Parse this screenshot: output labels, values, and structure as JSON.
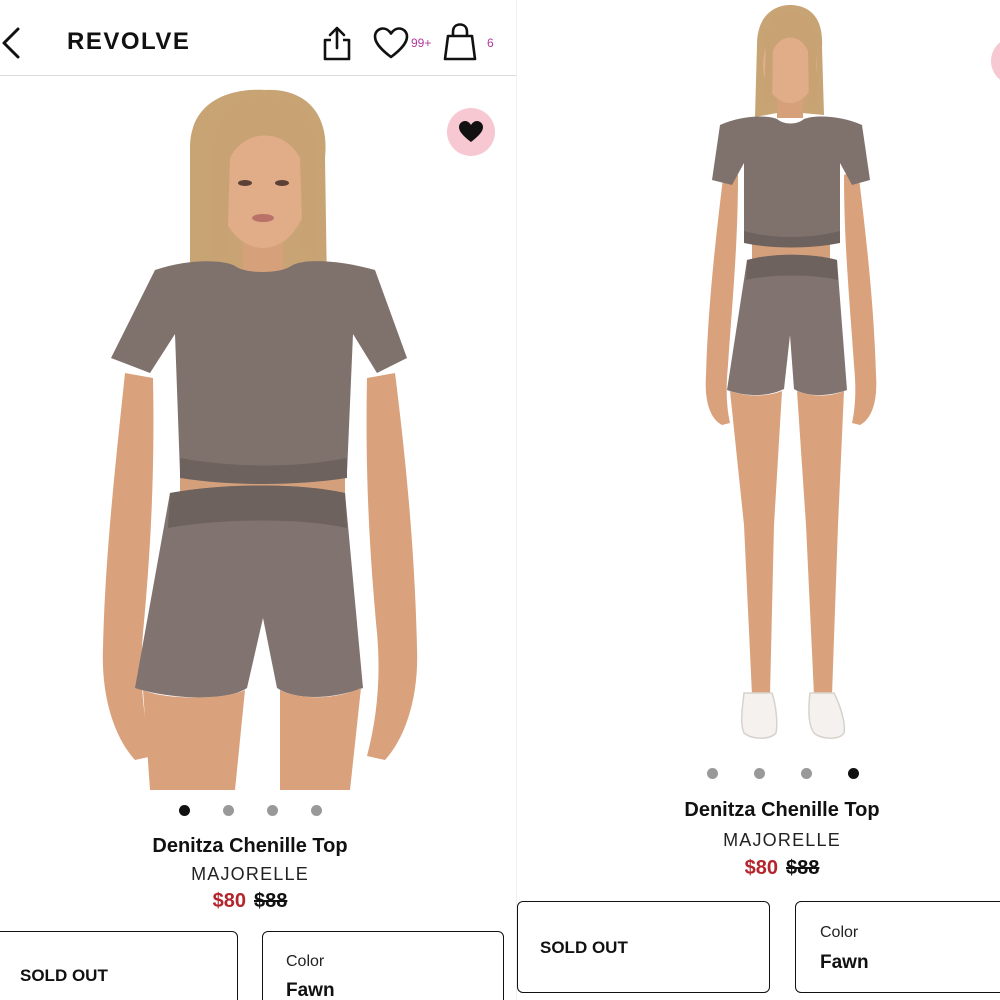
{
  "header": {
    "logo": "REVOLVE",
    "wishlist_count": "99+",
    "bag_count": "6"
  },
  "product": {
    "name": "Denitza Chenille Top",
    "brand": "MAJORELLE",
    "sale_price": "$80",
    "original_price": "$88"
  },
  "left_view": {
    "image_count": 4,
    "active_image": 1
  },
  "right_view": {
    "image_count": 4,
    "active_image": 4
  },
  "options": {
    "size_status": "SOLD OUT",
    "color_label": "Color",
    "color_value": "Fawn"
  },
  "icons": {
    "back": "chevron-left-icon",
    "share": "share-icon",
    "wishlist": "heart-outline-icon",
    "bag": "shopping-bag-icon",
    "favorite": "heart-filled-icon"
  },
  "colors": {
    "sale_price": "#b3262d",
    "badge_count": "#b03aa0",
    "favorite_bg": "#f7c7d2",
    "garment": "#7f726d"
  }
}
